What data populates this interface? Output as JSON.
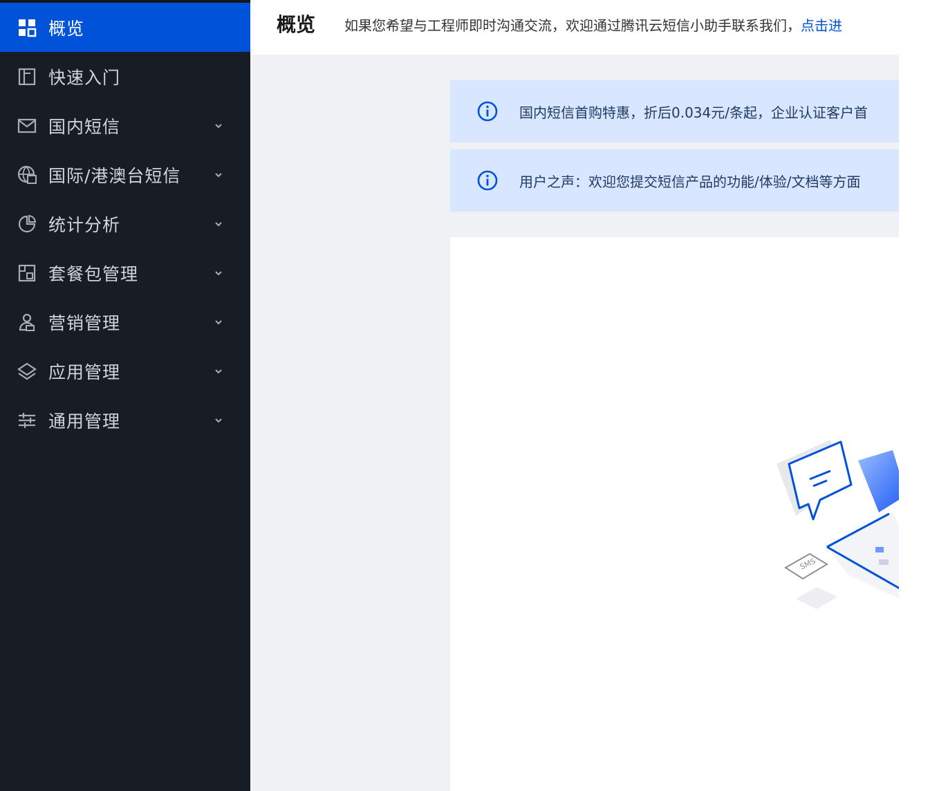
{
  "sidebar": {
    "items": [
      {
        "label": "概览",
        "icon": "grid-icon",
        "active": true,
        "expandable": false
      },
      {
        "label": "快速入门",
        "icon": "book-icon",
        "active": false,
        "expandable": false
      },
      {
        "label": "国内短信",
        "icon": "mail-icon",
        "active": false,
        "expandable": true
      },
      {
        "label": "国际/港澳台短信",
        "icon": "globe-message-icon",
        "active": false,
        "expandable": true
      },
      {
        "label": "统计分析",
        "icon": "pie-chart-icon",
        "active": false,
        "expandable": true
      },
      {
        "label": "套餐包管理",
        "icon": "package-icon",
        "active": false,
        "expandable": true
      },
      {
        "label": "营销管理",
        "icon": "users-icon",
        "active": false,
        "expandable": true
      },
      {
        "label": "应用管理",
        "icon": "layers-icon",
        "active": false,
        "expandable": true
      },
      {
        "label": "通用管理",
        "icon": "sliders-icon",
        "active": false,
        "expandable": true
      }
    ]
  },
  "header": {
    "title": "概览",
    "note": "如果您希望与工程师即时沟通交流，欢迎通过腾讯云短信小助手联系我们，",
    "link": "点击进"
  },
  "banners": [
    {
      "text": "国内短信首购特惠，折后0.034元/条起，企业认证客户首"
    },
    {
      "text": "用户之声：欢迎您提交短信产品的功能/体验/文档等方面"
    }
  ],
  "illustration": {
    "sms_label": "SMS"
  },
  "colors": {
    "sidebar_bg": "#181c25",
    "active_bg": "#0052d9",
    "banner_bg": "#d9e6ff",
    "accent": "#0052d9"
  }
}
